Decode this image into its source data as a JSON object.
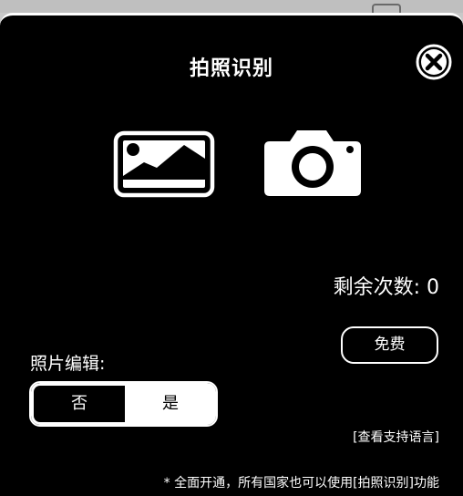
{
  "dialog": {
    "title": "拍照识别",
    "close_icon": "close-circle-icon",
    "gallery_icon": "image-icon",
    "camera_icon": "camera-icon",
    "remaining_label": "剩余次数: 0",
    "free_button": "免费",
    "photo_edit_label": "照片编辑:",
    "toggle": {
      "no": "否",
      "yes": "是",
      "selected": "是"
    },
    "supported_languages_link": "[查看支持语言]",
    "footnote": "* 全面开通，所有国家也可以使用[拍照识别]功能"
  },
  "colors": {
    "background": "#000000",
    "foreground": "#ffffff",
    "backdrop": "#c8c8c8"
  }
}
